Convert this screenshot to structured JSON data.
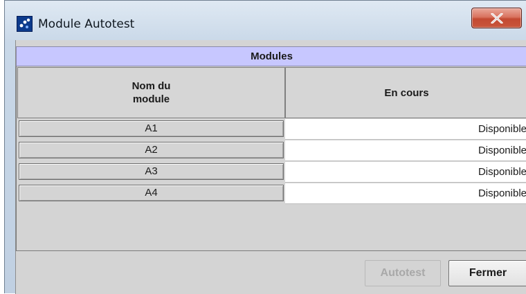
{
  "window": {
    "title": "Module Autotest",
    "close_symbol": "X"
  },
  "modules": {
    "header": "Modules",
    "columns": {
      "name": "Nom du\nmodule",
      "status": "En cours"
    },
    "rows": [
      {
        "name": "A1",
        "status": "Disponible"
      },
      {
        "name": "A2",
        "status": "Disponible"
      },
      {
        "name": "A3",
        "status": "Disponible"
      },
      {
        "name": "A4",
        "status": "Disponible"
      }
    ]
  },
  "footer": {
    "autotest_label": "Autotest",
    "autotest_enabled": false,
    "close_label": "Fermer"
  },
  "colors": {
    "modules_header_bg": "#c7c7ff",
    "close_button": "#c9563c",
    "panel_bg": "#d4d4d4"
  },
  "icons": {
    "app": "app-logo-icon",
    "close": "close-icon"
  }
}
